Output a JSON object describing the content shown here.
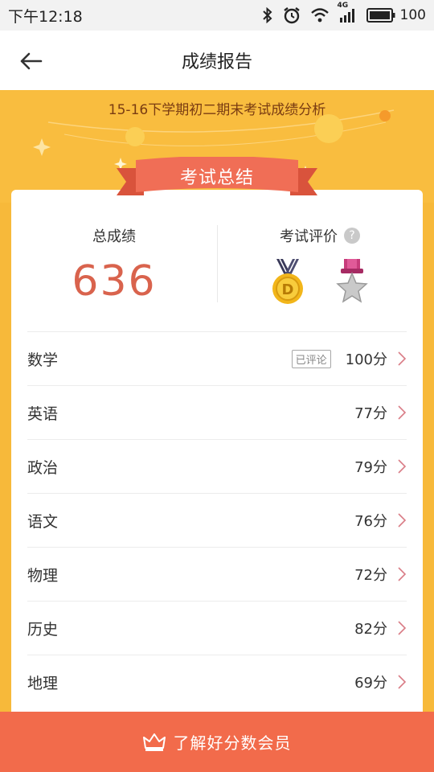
{
  "status_bar": {
    "time": "下午12:18",
    "network": "4G",
    "battery": "100"
  },
  "nav": {
    "title": "成绩报告"
  },
  "banner": {
    "subtitle": "15-16下学期初二期末考试成绩分析",
    "ribbon_label": "考试总结"
  },
  "summary": {
    "total_label": "总成绩",
    "total_score": "636",
    "evaluation_label": "考试评价",
    "help_glyph": "?"
  },
  "medals": [
    {
      "name": "gold-medal-icon",
      "letter": "D"
    },
    {
      "name": "silver-star-medal-icon"
    }
  ],
  "subjects": [
    {
      "name": "数学",
      "badge": "已评论",
      "score": "100分"
    },
    {
      "name": "英语",
      "score": "77分"
    },
    {
      "name": "政治",
      "score": "79分"
    },
    {
      "name": "语文",
      "score": "76分"
    },
    {
      "name": "物理",
      "score": "72分"
    },
    {
      "name": "历史",
      "score": "82分"
    },
    {
      "name": "地理",
      "score": "69分"
    }
  ],
  "bottom": {
    "label": "了解好分数会员"
  },
  "colors": {
    "accent": "#f26b4b",
    "banner": "#f9bd3f",
    "score": "#d9634d",
    "ribbon": "#f06e56"
  }
}
